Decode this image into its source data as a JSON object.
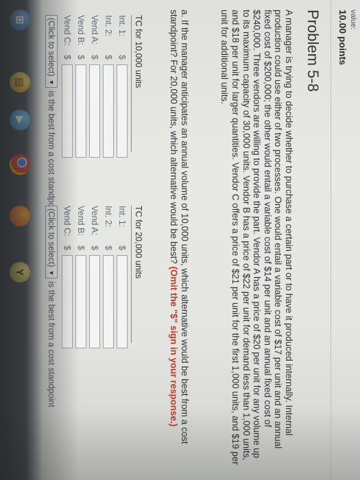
{
  "header": {
    "value_label": "value:",
    "points": "10.00 points"
  },
  "problem": {
    "title": "Problem 5-8",
    "text": "A manager is trying to decide whether to purchase a certain part or to have it produced internally. Internal production could use either of two processes. One would entail a variable cost of $17 per unit and an annual fixed cost of $200,000; the other would entail a variable cost of $14 per unit and an annual fixed cost of $240,000. Three vendors are willing to provide the part. Vendor A has a price of $20 per unit for any volume up to its maximum capacity of 30,000 units. Vendor B has a price of $22 per unit for demand less than 1,000 units, and $18 per unit for larger quantities. Vendor C offers a price of $21 per unit for the first 1,000 units, and $19 per unit for additional units."
  },
  "question": {
    "text": "a. If the manager anticipates an annual volume of 10,000 units, which alternative would be best from a cost standpoint? For 20,000 units, which alternative would be best?",
    "instruction": "(Omit the \"$\" sign in your response.)"
  },
  "tc10": {
    "header": "TC for 10,000 units",
    "rows": [
      {
        "label": "Int. 1:",
        "dollar": "$",
        "value": ""
      },
      {
        "label": "Int. 2:",
        "dollar": "$",
        "value": ""
      },
      {
        "label": "Vend A:",
        "dollar": "$",
        "value": ""
      },
      {
        "label": "Vend B:",
        "dollar": "$",
        "value": ""
      },
      {
        "label": "Vend C:",
        "dollar": "$",
        "value": ""
      }
    ],
    "select_label": "(Click to select)",
    "select_suffix": "is the best from a cost standpoint"
  },
  "tc20": {
    "header": "TC for 20,000 units",
    "rows": [
      {
        "label": "Int. 1:",
        "dollar": "$",
        "value": ""
      },
      {
        "label": "Int. 2:",
        "dollar": "$",
        "value": ""
      },
      {
        "label": "Vend A:",
        "dollar": "$",
        "value": ""
      },
      {
        "label": "Vend B:",
        "dollar": "$",
        "value": ""
      },
      {
        "label": "Vend C:",
        "dollar": "$",
        "value": ""
      }
    ],
    "select_label": "(Click to select)",
    "select_suffix": "is the best from a cost standpoint"
  },
  "taskbar": {
    "icons": [
      "windows-start-icon",
      "file-explorer-icon",
      "media-player-icon",
      "chrome-icon",
      "firefox-icon",
      "cursor-app-icon"
    ],
    "start_glyph": "⊞",
    "cursor_glyph": "Y"
  },
  "colors": {
    "instruction": "#c0392b",
    "input_border": "#9aa3ab"
  }
}
